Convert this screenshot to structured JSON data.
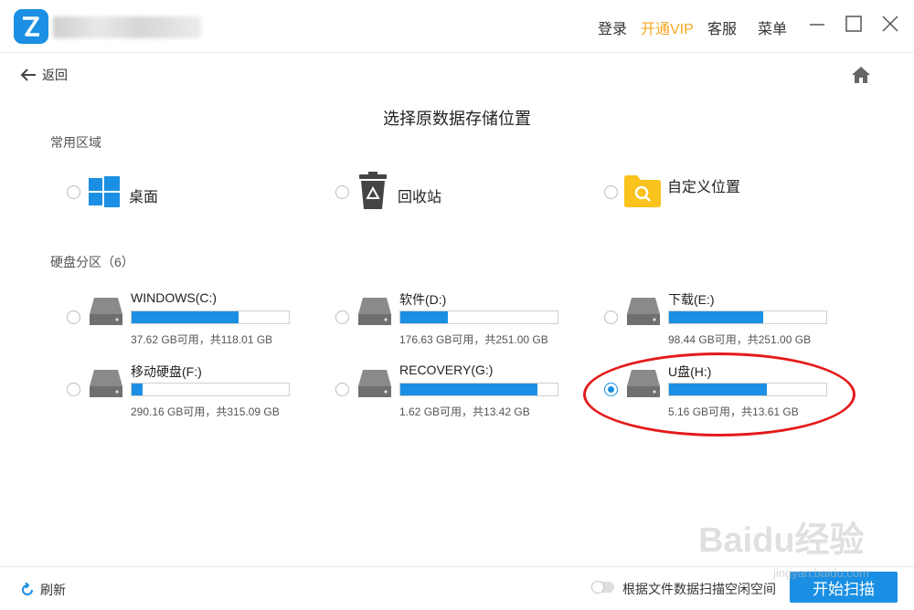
{
  "header": {
    "menu": [
      {
        "label": "登录"
      },
      {
        "label": "开通VIP",
        "color": "#f5a623"
      },
      {
        "label": "客服"
      },
      {
        "label": "菜单"
      }
    ]
  },
  "nav": {
    "back_label": "返回"
  },
  "page_title": "选择原数据存储位置",
  "common_section": {
    "label": "常用区域",
    "items": [
      {
        "label": "桌面",
        "icon": "windows-icon"
      },
      {
        "label": "回收站",
        "icon": "recycle-bin-icon"
      },
      {
        "label": "自定义位置",
        "icon": "folder-search-icon"
      }
    ]
  },
  "drive_section": {
    "label": "硬盘分区（6）",
    "drives": [
      {
        "name": "WINDOWS(C:)",
        "info": "37.62 GB可用，共118.01 GB",
        "used_fraction": 0.68,
        "selected": false
      },
      {
        "name": "软件(D:)",
        "info": "176.63 GB可用，共251.00 GB",
        "used_fraction": 0.3,
        "selected": false
      },
      {
        "name": "下载(E:)",
        "info": "98.44 GB可用，共251.00 GB",
        "used_fraction": 0.6,
        "selected": false
      },
      {
        "name": "移动硬盘(F:)",
        "info": "290.16 GB可用，共315.09 GB",
        "used_fraction": 0.07,
        "selected": false
      },
      {
        "name": "RECOVERY(G:)",
        "info": "1.62 GB可用，共13.42 GB",
        "used_fraction": 0.87,
        "selected": false
      },
      {
        "name": "U盘(H:)",
        "info": "5.16 GB可用，共13.61 GB",
        "used_fraction": 0.62,
        "selected": true
      }
    ]
  },
  "footer": {
    "refresh_label": "刷新",
    "toggle_label": "根据文件数据扫描空闲空间",
    "toggle_on": false,
    "scan_button": "开始扫描"
  },
  "watermark": {
    "text": "Baidu经验",
    "subtext": "jingyan.baidu.com"
  },
  "colors": {
    "accent": "#1a8fe3",
    "vip": "#f5a623",
    "annotation": "#e41a1a"
  }
}
